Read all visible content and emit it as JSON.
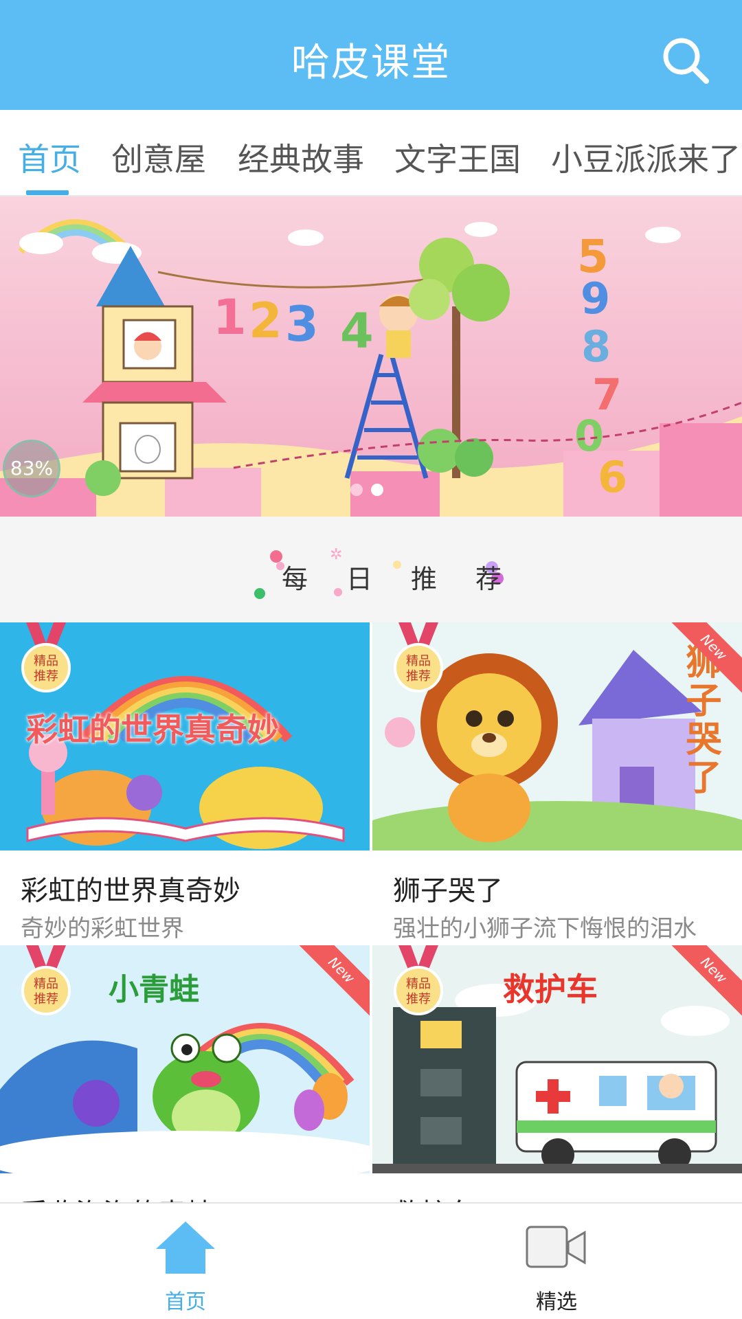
{
  "header": {
    "title": "哈皮课堂",
    "search_icon": "search-icon"
  },
  "tabs": [
    {
      "label": "首页",
      "active": true
    },
    {
      "label": "创意屋"
    },
    {
      "label": "经典故事"
    },
    {
      "label": "文字王国"
    },
    {
      "label": "小豆派派来了"
    }
  ],
  "banner": {
    "progress": "83%",
    "dots": 2,
    "active_dot": 1
  },
  "daily": {
    "label": "每日推荐"
  },
  "cards": [
    {
      "title": "彩虹的世界真奇妙",
      "desc": "奇妙的彩虹世界",
      "badge": "精品推荐",
      "new": "",
      "art_text": "彩虹的世界真奇妙"
    },
    {
      "title": "狮子哭了",
      "desc": "强壮的小狮子流下悔恨的泪水",
      "badge": "精品推荐",
      "new": "New",
      "art_text": "狮子哭了"
    },
    {
      "title": "采收泡泡的毒蛙",
      "desc": "",
      "badge": "精品推荐",
      "new": "New",
      "art_text": "小青蛙"
    },
    {
      "title": "救护车",
      "desc": "",
      "badge": "精品推荐",
      "new": "New",
      "art_text": "救护车"
    }
  ],
  "bottom_nav": [
    {
      "label": "首页",
      "icon": "home-icon",
      "active": true
    },
    {
      "label": "精选",
      "icon": "video-camera-icon",
      "active": false
    }
  ],
  "colors": {
    "primary": "#5bbdf3",
    "accent": "#45aee6",
    "ribbon": "#f25b5b"
  }
}
